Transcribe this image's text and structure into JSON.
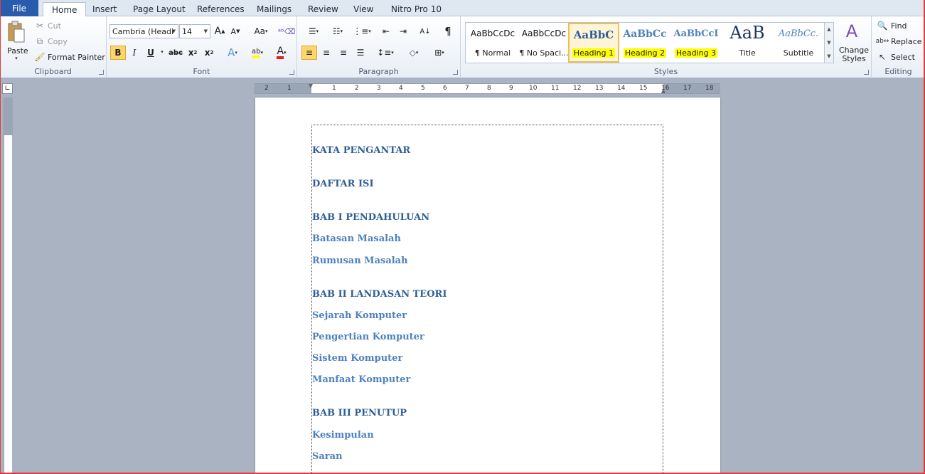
{
  "tabs": {
    "file": "File",
    "home": "Home",
    "insert": "Insert",
    "page_layout": "Page Layout",
    "references": "References",
    "mailings": "Mailings",
    "review": "Review",
    "view": "View",
    "nitro": "Nitro Pro 10"
  },
  "clipboard": {
    "label": "Clipboard",
    "paste": "Paste",
    "cut": "Cut",
    "copy": "Copy",
    "format_painter": "Format Painter"
  },
  "font": {
    "label": "Font",
    "family": "Cambria (Headi",
    "size": "14",
    "grow": "A",
    "shrink": "A",
    "change_case": "Aa",
    "bold": "B",
    "italic": "I",
    "underline": "U",
    "strike": "abc",
    "subscript": "x",
    "superscript": "x",
    "text_effects": "A",
    "highlight": "ab",
    "color": "A"
  },
  "paragraph": {
    "label": "Paragraph",
    "pilcrow": "¶"
  },
  "styles": {
    "label": "Styles",
    "items": [
      {
        "preview": "AaBbCcDc",
        "name": "¶ Normal"
      },
      {
        "preview": "AaBbCcDc",
        "name": "¶ No Spaci..."
      },
      {
        "preview": "AaBbC",
        "name": "Heading 1"
      },
      {
        "preview": "AaBbCc",
        "name": "Heading 2"
      },
      {
        "preview": "AaBbCcI",
        "name": "Heading 3"
      },
      {
        "preview": "AaB",
        "name": "Title"
      },
      {
        "preview": "AaBbCc.",
        "name": "Subtitle"
      }
    ],
    "change_styles": "Change Styles"
  },
  "editing": {
    "label": "Editing",
    "find": "Find",
    "replace": "Replace",
    "select": "Select"
  },
  "ruler": {
    "numbers": [
      "2",
      "1",
      "1",
      "2",
      "3",
      "4",
      "5",
      "6",
      "7",
      "8",
      "9",
      "10",
      "11",
      "12",
      "13",
      "14",
      "15",
      "16",
      "17",
      "18"
    ]
  },
  "document": {
    "lines": [
      {
        "text": "KATA PENGANTAR",
        "level": 1
      },
      {
        "text": "DAFTAR ISI",
        "level": 1
      },
      {
        "text": "BAB I PENDAHULUAN",
        "level": 1
      },
      {
        "text": "Batasan Masalah",
        "level": 2
      },
      {
        "text": "Rumusan Masalah",
        "level": 2
      },
      {
        "text": "BAB II LANDASAN TEORI",
        "level": 1
      },
      {
        "text": "Sejarah Komputer",
        "level": 2
      },
      {
        "text": "Pengertian  Komputer",
        "level": 2
      },
      {
        "text": "Sistem  Komputer",
        "level": 2
      },
      {
        "text": "Manfaat Komputer",
        "level": 2
      },
      {
        "text": "BAB III PENUTUP",
        "level": 1
      },
      {
        "text": "Kesimpulan",
        "level": 2
      },
      {
        "text": "Saran",
        "level": 2
      }
    ]
  }
}
